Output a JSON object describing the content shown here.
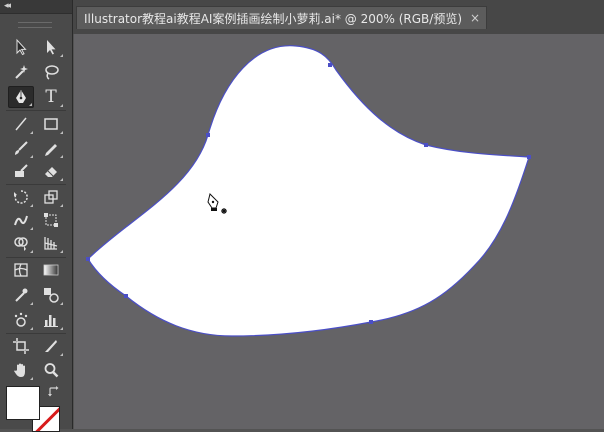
{
  "document": {
    "tab_title": "Illustrator教程ai教程AI案例插画绘制小萝莉.ai* @ 200% (RGB/预览)",
    "close_glyph": "×"
  },
  "toolbar": {
    "collapse_glyph": "◂◂",
    "tools": [
      {
        "name": "selection-tool",
        "icon": "selection-arrow-icon"
      },
      {
        "name": "direct-selection-tool",
        "icon": "direct-selection-arrow-icon"
      },
      {
        "name": "magic-wand-tool",
        "icon": "magic-wand-icon"
      },
      {
        "name": "lasso-tool",
        "icon": "lasso-icon"
      },
      {
        "name": "pen-tool",
        "icon": "pen-icon",
        "active": true
      },
      {
        "name": "type-tool",
        "icon": "type-icon",
        "label": "T"
      },
      {
        "name": "line-segment-tool",
        "icon": "line-icon"
      },
      {
        "name": "rectangle-tool",
        "icon": "rectangle-icon"
      },
      {
        "name": "paintbrush-tool",
        "icon": "paintbrush-icon"
      },
      {
        "name": "pencil-tool",
        "icon": "pencil-icon"
      },
      {
        "name": "blob-brush-tool",
        "icon": "blob-brush-icon"
      },
      {
        "name": "eraser-tool",
        "icon": "eraser-icon"
      },
      {
        "name": "rotate-tool",
        "icon": "rotate-icon"
      },
      {
        "name": "scale-tool",
        "icon": "scale-icon"
      },
      {
        "name": "warp-tool",
        "icon": "warp-icon"
      },
      {
        "name": "free-transform-tool",
        "icon": "free-transform-icon"
      },
      {
        "name": "shape-builder-tool",
        "icon": "shape-builder-icon"
      },
      {
        "name": "perspective-grid-tool",
        "icon": "perspective-grid-icon"
      },
      {
        "name": "mesh-tool",
        "icon": "mesh-icon"
      },
      {
        "name": "gradient-tool",
        "icon": "gradient-icon"
      },
      {
        "name": "eyedropper-tool",
        "icon": "eyedropper-icon"
      },
      {
        "name": "blend-tool",
        "icon": "blend-icon"
      },
      {
        "name": "symbol-sprayer-tool",
        "icon": "symbol-sprayer-icon"
      },
      {
        "name": "column-graph-tool",
        "icon": "column-graph-icon"
      },
      {
        "name": "artboard-tool",
        "icon": "artboard-icon"
      },
      {
        "name": "slice-tool",
        "icon": "slice-icon"
      },
      {
        "name": "hand-tool",
        "icon": "hand-icon"
      },
      {
        "name": "zoom-tool",
        "icon": "zoom-icon"
      }
    ],
    "fill_color": "#ffffff",
    "stroke_color": "none",
    "swap_icon": "swap-arrow-icon"
  },
  "canvas": {
    "background": "#646366",
    "path_fill": "#ffffff",
    "path_stroke": "#4b4fc6",
    "cursor_icon": "pen-add-anchor-cursor-icon"
  }
}
